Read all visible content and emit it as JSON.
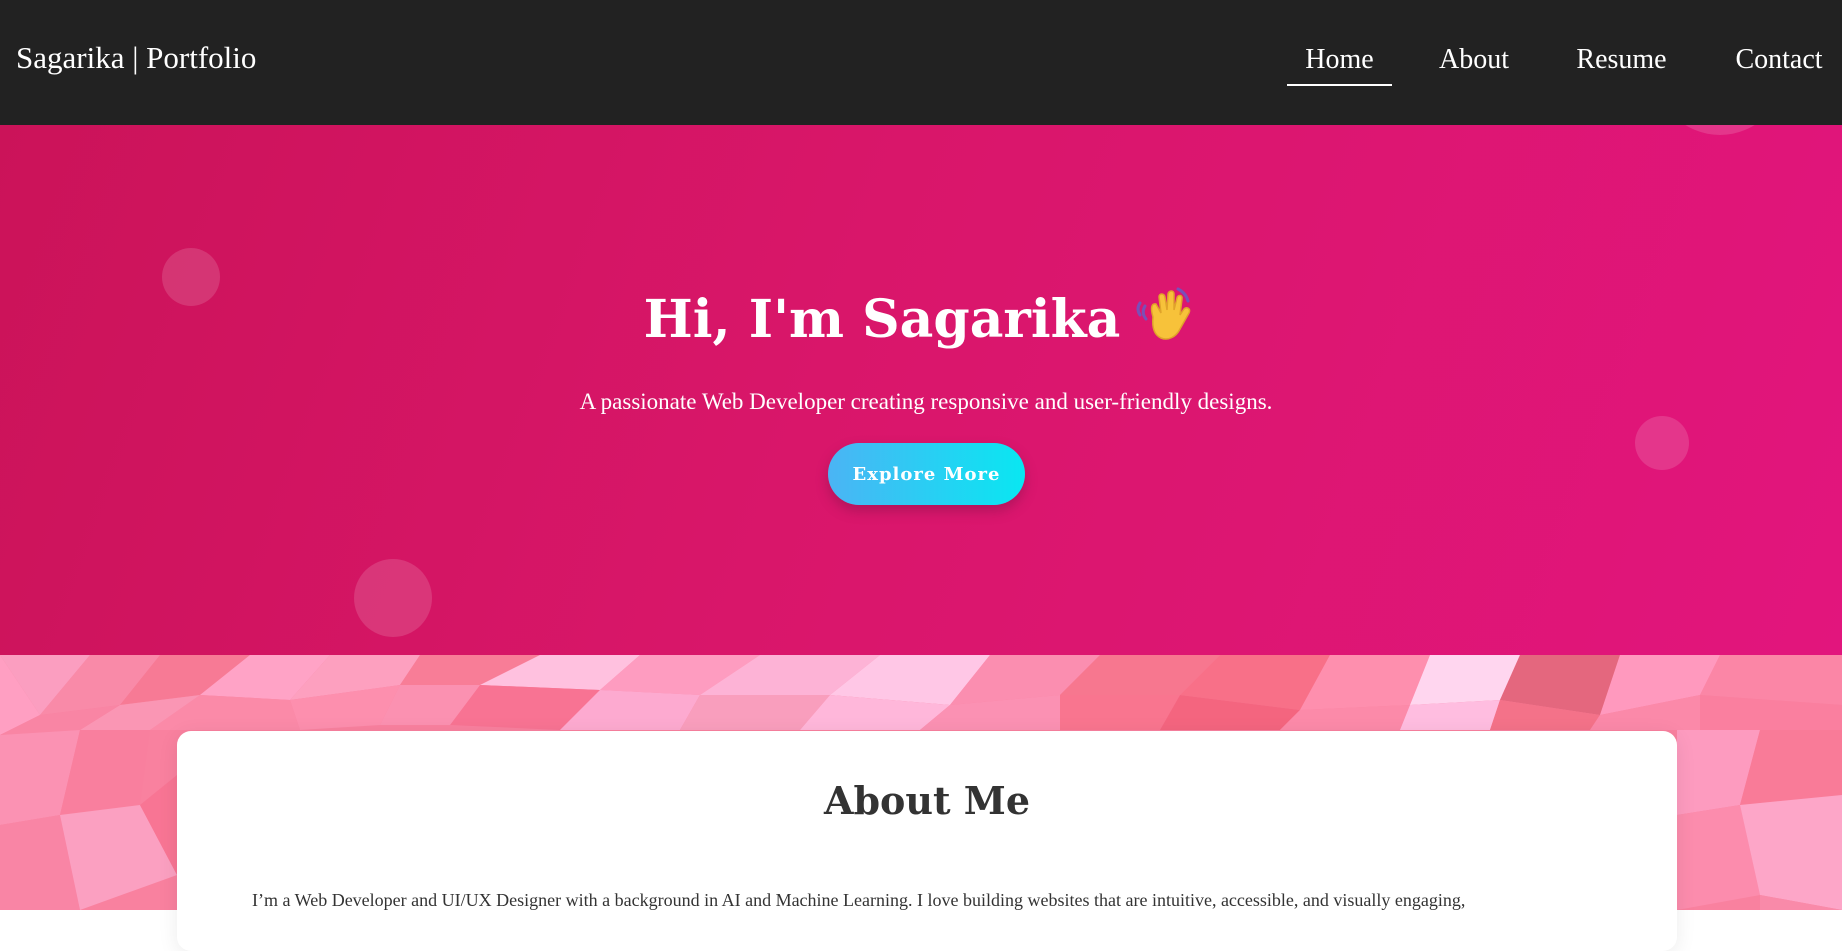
{
  "nav": {
    "brand": "Sagarika | Portfolio",
    "links": [
      {
        "label": "Home",
        "active": true
      },
      {
        "label": "About",
        "active": false
      },
      {
        "label": "Resume",
        "active": false
      },
      {
        "label": "Contact",
        "active": false
      }
    ]
  },
  "hero": {
    "title": "Hi, I'm Sagarika",
    "title_icon": "waving-hand-icon",
    "subtitle": "A passionate Web Developer creating responsive and user-friendly designs.",
    "button_label": "Explore More"
  },
  "about": {
    "title": "About Me",
    "text": "I’m a Web Developer and UI/UX Designer with a background in AI and Machine Learning. I love building websites that are intuitive, accessible, and visually engaging,"
  },
  "colors": {
    "navbar": "#222222",
    "hero_gradient_start": "#cb1359",
    "hero_gradient_end": "#e2157d",
    "button_gradient_start": "#4bb4f4",
    "button_gradient_end": "#09e7f2",
    "pattern_base": "#f9819f",
    "card": "#ffffff",
    "heading_text": "#333333"
  }
}
